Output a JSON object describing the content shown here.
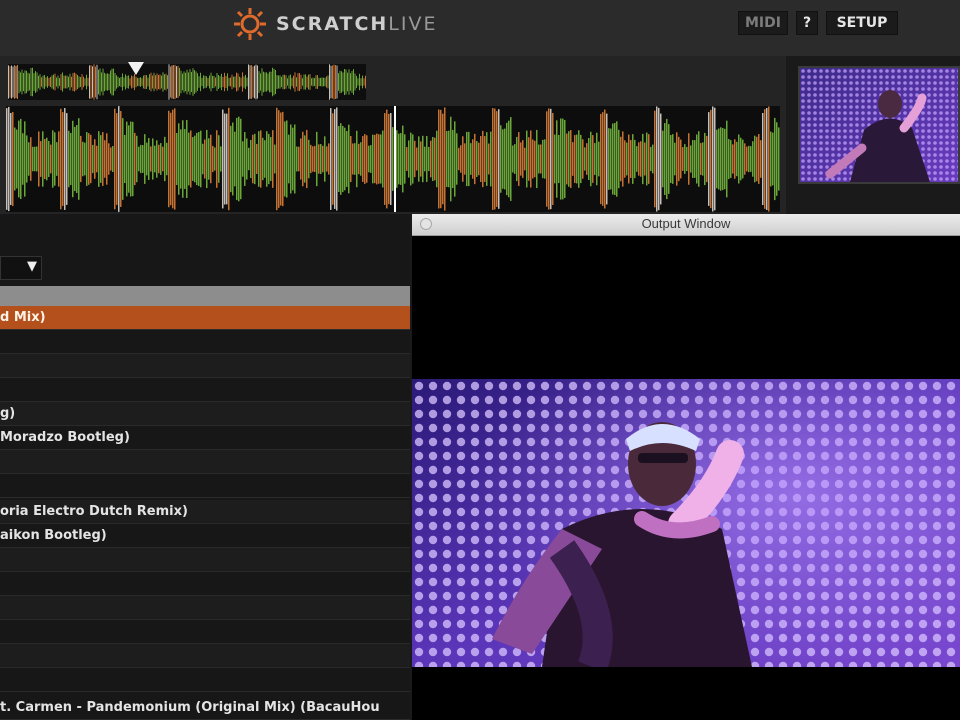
{
  "app": {
    "name_main": "SCRATCH",
    "name_sub": "LIVE"
  },
  "toolbar": {
    "midi_label": "MIDI",
    "help_label": "?",
    "setup_label": "SETUP"
  },
  "colors": {
    "accent_selected_row": "#b3501c",
    "waveform_green": "#7dc242",
    "waveform_orange": "#e8853a",
    "waveform_white": "#e8e0d8",
    "dots_purple": "#9b6cff"
  },
  "output_window": {
    "title": "Output Window"
  },
  "library": {
    "rows": [
      {
        "text": "d Mix)",
        "selected": true
      },
      {
        "text": ""
      },
      {
        "text": ""
      },
      {
        "text": ""
      },
      {
        "text": "g)"
      },
      {
        "text": "Moradzo Bootleg)"
      },
      {
        "text": ""
      },
      {
        "text": ""
      },
      {
        "text": "oria Electro Dutch Remix)"
      },
      {
        "text": "aikon Bootleg)"
      },
      {
        "text": ""
      },
      {
        "text": ""
      },
      {
        "text": ""
      },
      {
        "text": ""
      },
      {
        "text": ""
      },
      {
        "text": ""
      },
      {
        "text": "t. Carmen - Pandemonium (Original Mix) (BacauHou"
      }
    ]
  }
}
